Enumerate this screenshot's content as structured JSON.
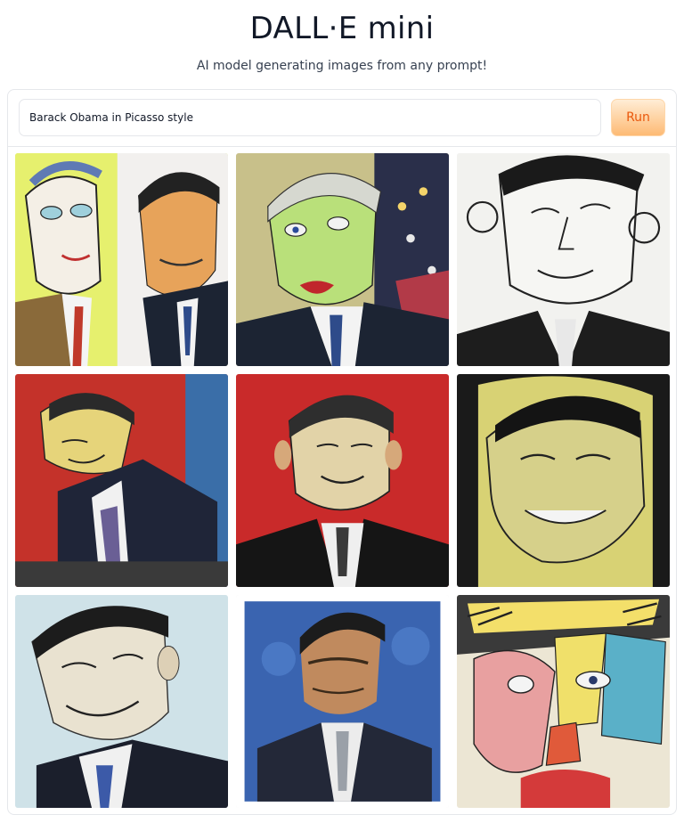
{
  "header": {
    "title": "DALL·E mini",
    "subtitle": "AI model generating images from any prompt!"
  },
  "prompt": {
    "value": "Barack Obama in Picasso style"
  },
  "run_button": {
    "label": "Run"
  },
  "colors": {
    "accent": "#ea580c",
    "button_gradient_top": "#ffedd5",
    "button_gradient_bottom": "#fdba74",
    "border": "#e5e7eb"
  }
}
